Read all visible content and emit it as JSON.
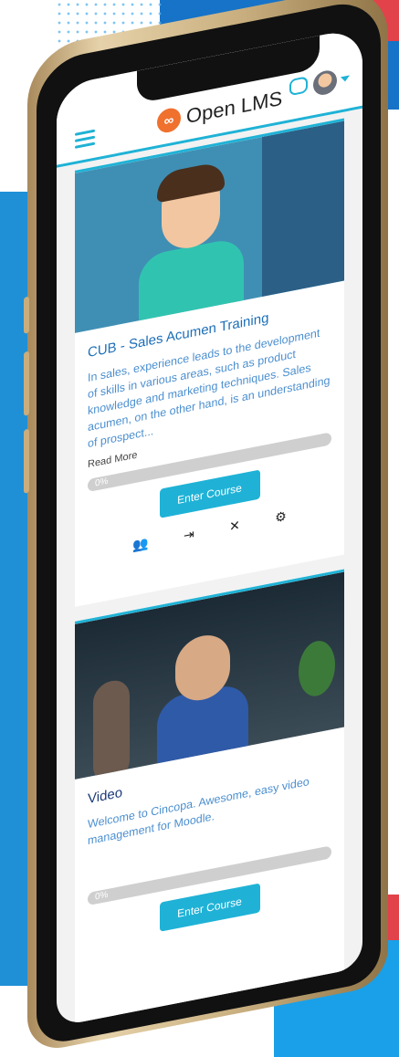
{
  "app": {
    "logo_mark": "∞",
    "logo_text": "Open LMS"
  },
  "colors": {
    "accent": "#1fb2d6",
    "brand_orange": "#f0702e",
    "background_blue": "#1f8fd6",
    "background_red": "#e2424a"
  },
  "icons": {
    "menu": "hamburger-icon",
    "messages": "chat-icon",
    "user": "avatar",
    "dropdown": "caret-down-icon"
  },
  "courses": [
    {
      "title": "CUB - Sales Acumen Training",
      "description": "In sales, experience leads to the development of skills in various areas, such as product knowledge and marketing techniques. Sales acumen, on the other hand, is an understanding of prospect...",
      "read_more": "Read More",
      "progress_label": "0%",
      "button": "Enter Course",
      "action_icons": [
        "users-icon",
        "enrol-icon",
        "close-icon",
        "gear-icon"
      ],
      "action_glyphs": [
        "👥",
        "⇥",
        "✕",
        "⚙"
      ]
    },
    {
      "title": "Video",
      "description": "Welcome to Cincopa. Awesome, easy video management for Moodle.",
      "progress_label": "0%",
      "button": "Enter Course"
    }
  ]
}
